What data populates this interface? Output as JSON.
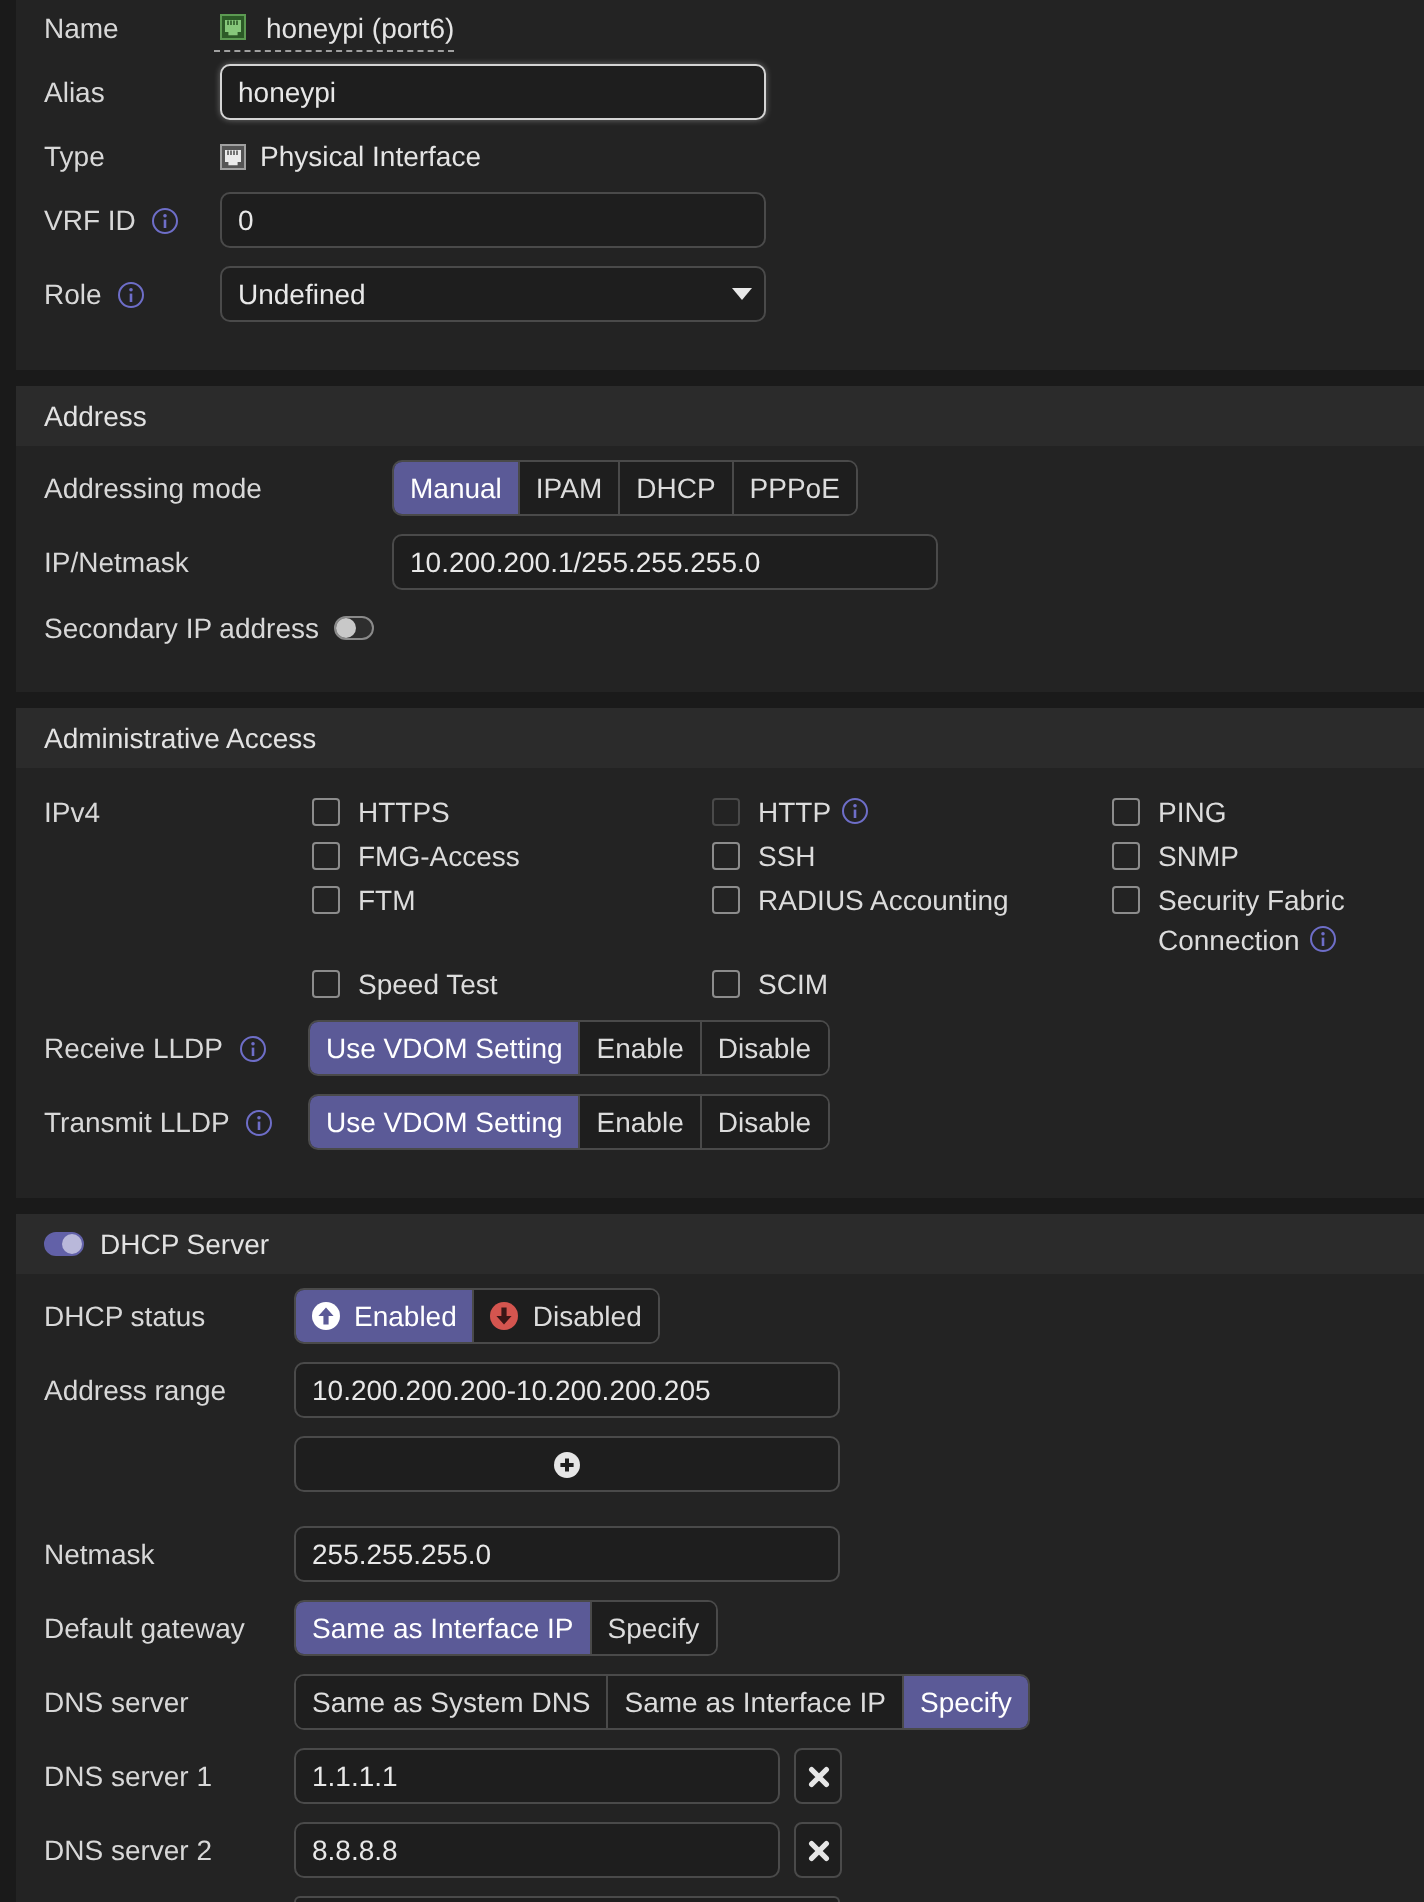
{
  "general": {
    "rows": [
      {
        "kind": "link",
        "label": "Name",
        "value": "honeypi (port6)"
      },
      {
        "kind": "input",
        "label": "Alias",
        "value": "honeypi",
        "focused": true
      },
      {
        "kind": "text",
        "label": "Type",
        "value": "Physical Interface"
      },
      {
        "kind": "input",
        "label": "VRF ID",
        "info": true,
        "value": "0",
        "focused": false
      },
      {
        "kind": "select",
        "label": "Role",
        "info": true,
        "value": "Undefined"
      }
    ]
  },
  "address": {
    "title": "Address",
    "rows": [
      {
        "kind": "segmented",
        "label": "Addressing mode",
        "options": [
          {
            "label": "Manual",
            "selected": true
          },
          {
            "label": "IPAM",
            "selected": false
          },
          {
            "label": "DHCP",
            "selected": false
          },
          {
            "label": "PPPoE",
            "selected": false
          }
        ]
      },
      {
        "kind": "input",
        "label": "IP/Netmask",
        "value": "10.200.200.1/255.255.255.0",
        "focused": false
      },
      {
        "kind": "toggle",
        "label": "Secondary IP address",
        "on": false
      }
    ]
  },
  "admin_access": {
    "title": "Administrative Access",
    "ipv4_label": "IPv4",
    "protocols": [
      {
        "label": "HTTPS",
        "checked": false,
        "disabled": false
      },
      {
        "label": "HTTP",
        "checked": false,
        "disabled": true,
        "info": true
      },
      {
        "label": "PING",
        "checked": false,
        "disabled": false
      },
      {
        "label": "FMG-Access",
        "checked": false,
        "disabled": false
      },
      {
        "label": "SSH",
        "checked": false,
        "disabled": false
      },
      {
        "label": "SNMP",
        "checked": false,
        "disabled": false
      },
      {
        "label": "FTM",
        "checked": false,
        "disabled": false
      },
      {
        "label": "RADIUS Accounting",
        "checked": false,
        "disabled": false
      },
      {
        "label": "Security Fabric Connection",
        "checked": false,
        "disabled": false,
        "info": true
      },
      {
        "label": "Speed Test",
        "checked": false,
        "disabled": false
      },
      {
        "label": "SCIM",
        "checked": false,
        "disabled": false
      }
    ],
    "rows": [
      {
        "kind": "segmented",
        "label": "Receive LLDP",
        "info": true,
        "options": [
          {
            "label": "Use VDOM Setting",
            "selected": true
          },
          {
            "label": "Enable",
            "selected": false
          },
          {
            "label": "Disable",
            "selected": false
          }
        ]
      },
      {
        "kind": "segmented",
        "label": "Transmit LLDP",
        "info": true,
        "options": [
          {
            "label": "Use VDOM Setting",
            "selected": true
          },
          {
            "label": "Enable",
            "selected": false
          },
          {
            "label": "Disable",
            "selected": false
          }
        ]
      }
    ]
  },
  "dhcp_server": {
    "title": "DHCP Server",
    "on": true,
    "rows": [
      {
        "kind": "segmented",
        "label": "DHCP status",
        "options": [
          {
            "label": "Enabled",
            "selected": true,
            "kind": "up"
          },
          {
            "label": "Disabled",
            "selected": false,
            "kind": "down"
          }
        ]
      },
      {
        "kind": "input",
        "label": "Address range",
        "value": "10.200.200.200-10.200.200.205",
        "focused": false
      },
      {
        "kind": "add_button"
      },
      {
        "kind": "input",
        "label": "Netmask",
        "value": "255.255.255.0",
        "focused": false
      },
      {
        "kind": "segmented",
        "label": "Default gateway",
        "options": [
          {
            "label": "Same as Interface IP",
            "selected": true
          },
          {
            "label": "Specify",
            "selected": false
          }
        ]
      },
      {
        "kind": "segmented",
        "label": "DNS server",
        "options": [
          {
            "label": "Same as System DNS",
            "selected": false
          },
          {
            "label": "Same as Interface IP",
            "selected": false
          },
          {
            "label": "Specify",
            "selected": true
          }
        ]
      },
      {
        "kind": "removable_input",
        "label": "DNS server 1",
        "value": "1.1.1.1",
        "focused": false
      },
      {
        "kind": "removable_input",
        "label": "DNS server 2",
        "value": "8.8.8.8",
        "focused": false
      },
      {
        "kind": "cut_input"
      }
    ]
  }
}
